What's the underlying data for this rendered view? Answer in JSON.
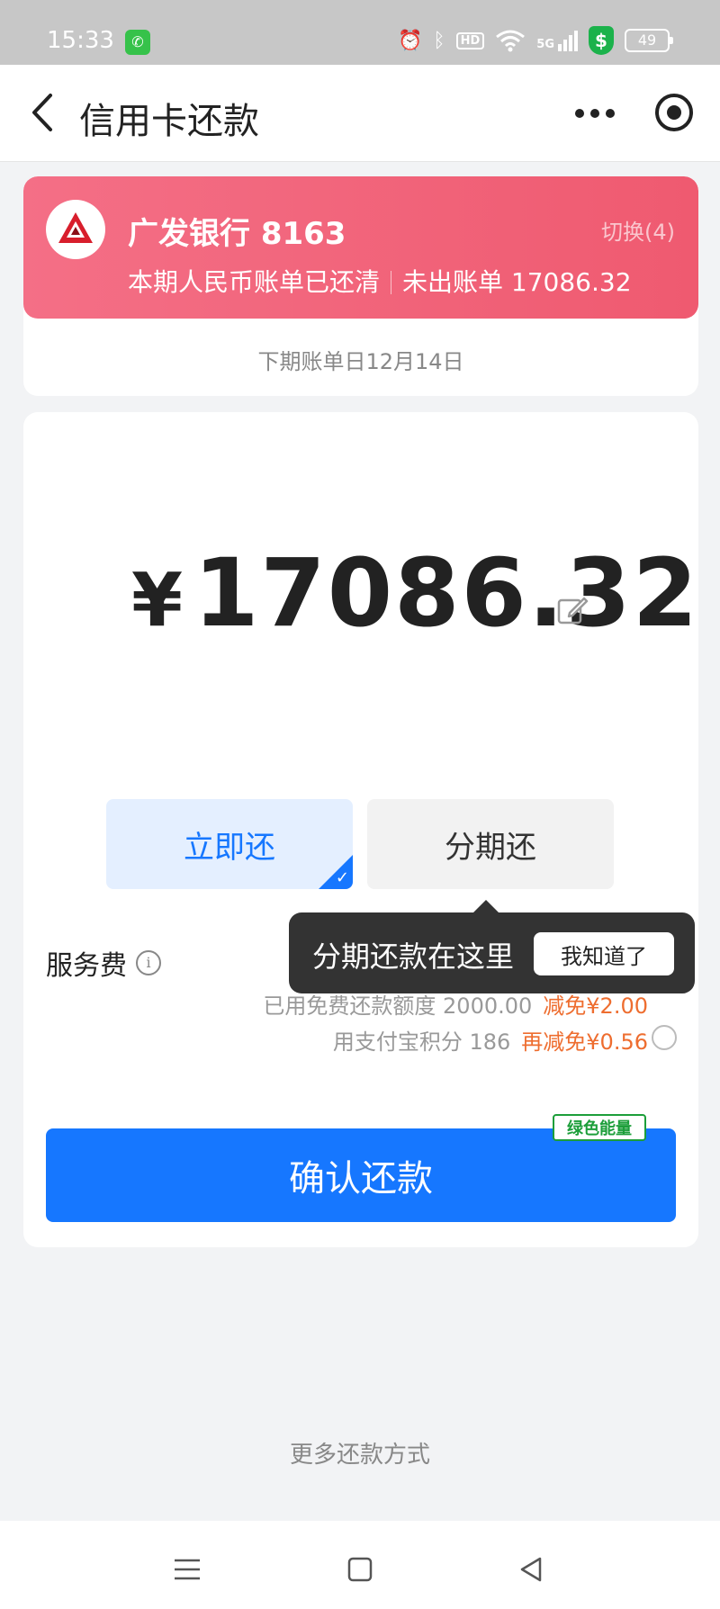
{
  "status_bar": {
    "time": "15:33",
    "network": "5G",
    "hd_label": "HD",
    "battery": "49"
  },
  "header": {
    "title": "信用卡还款"
  },
  "card": {
    "bank_name": "广发银行 8163",
    "switch_label": "切换(4)",
    "status_paid": "本期人民币账单已还清",
    "status_unbilled": "未出账单 17086.32",
    "next_bill_date": "下期账单日12月14日"
  },
  "payment": {
    "currency_symbol": "¥",
    "amount": "17086.32",
    "option_now": "立即还",
    "option_installment": "分期还"
  },
  "service_fee": {
    "label": "服务费",
    "free_quota": "已用免费还款额度 2000.00",
    "free_discount": "减免¥2.00",
    "points": "用支付宝积分 186",
    "points_discount": "再减免¥0.56"
  },
  "tooltip": {
    "text": "分期还款在这里",
    "button": "我知道了"
  },
  "confirm": {
    "label": "确认还款",
    "badge": "绿色能量"
  },
  "footer": {
    "more_methods": "更多还款方式"
  },
  "colors": {
    "primary": "#1677ff",
    "banner_start": "#f46f86",
    "banner_end": "#ef5a70",
    "discount": "#ee6d2f",
    "green": "#1c9e3a"
  }
}
